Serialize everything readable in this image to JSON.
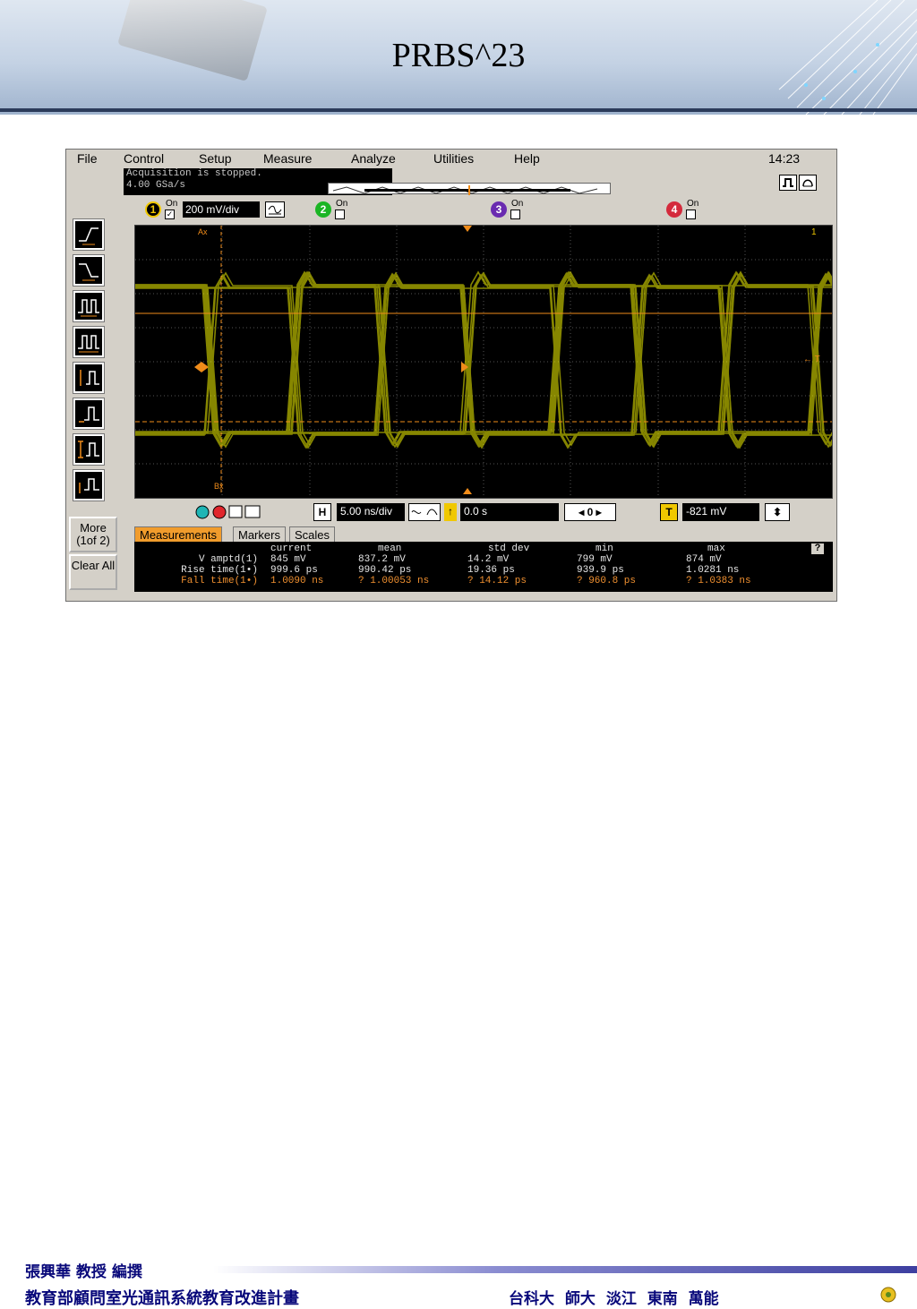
{
  "slide": {
    "title": "PRBS^23"
  },
  "menu": {
    "items": [
      "File",
      "Control",
      "Setup",
      "Measure",
      "Analyze",
      "Utilities",
      "Help"
    ],
    "clock": "14:23"
  },
  "status": {
    "line1": "Acquisition is stopped.",
    "line2": "4.00 GSa/s"
  },
  "channels": [
    {
      "num": "1",
      "on_label": "On",
      "checked": true,
      "scale": "200 mV/div",
      "color": "#f0c800"
    },
    {
      "num": "2",
      "on_label": "On",
      "checked": false,
      "color": "#1bb524"
    },
    {
      "num": "3",
      "on_label": "On",
      "checked": false,
      "color": "#6a2bb0"
    },
    {
      "num": "4",
      "on_label": "On",
      "checked": false,
      "color": "#d42a3c"
    }
  ],
  "side_buttons": {
    "more": "More (1of 2)",
    "clear": "Clear All"
  },
  "graticule": {
    "marker_a": "Ax",
    "marker_b": "Bx",
    "trigger_label": "← T",
    "ch1_marker": "1",
    "trace_color": "#f5f500",
    "marker_color": "#f08c1a"
  },
  "controls": {
    "h_label": "H",
    "timebase": "5.00 ns/div",
    "delay": "0.0 s",
    "trig_label": "T",
    "trig_level": "-821 mV"
  },
  "measurements": {
    "tabs": [
      "Measurements",
      "Markers",
      "Scales"
    ],
    "headers": [
      "current",
      "mean",
      "std dev",
      "min",
      "max"
    ],
    "help": "?",
    "rows": [
      {
        "name": "V amptd(1)",
        "current": "845 mV",
        "mean": "837.2 mV",
        "stddev": "14.2 mV",
        "min": "799 mV",
        "max": "874 mV",
        "color": "#e6e6e6"
      },
      {
        "name": "Rise time(1•)",
        "current": "999.6 ps",
        "mean": "990.42 ps",
        "stddev": "19.36 ps",
        "min": "939.9 ps",
        "max": "1.0281 ns",
        "color": "#e6e6e6"
      },
      {
        "name": "Fall time(1•)",
        "current": "1.0090 ns",
        "mean": "? 1.00053 ns",
        "stddev": "? 14.12 ps",
        "min": "? 960.8 ps",
        "max": "? 1.0383 ns",
        "color": "#f09030"
      }
    ]
  },
  "footer": {
    "author": "張興華 教授 編撰",
    "project": "教育部顧問室光通訊系統教育改進計畫",
    "schools": "台科大 師大 淡江 東南 萬能"
  }
}
